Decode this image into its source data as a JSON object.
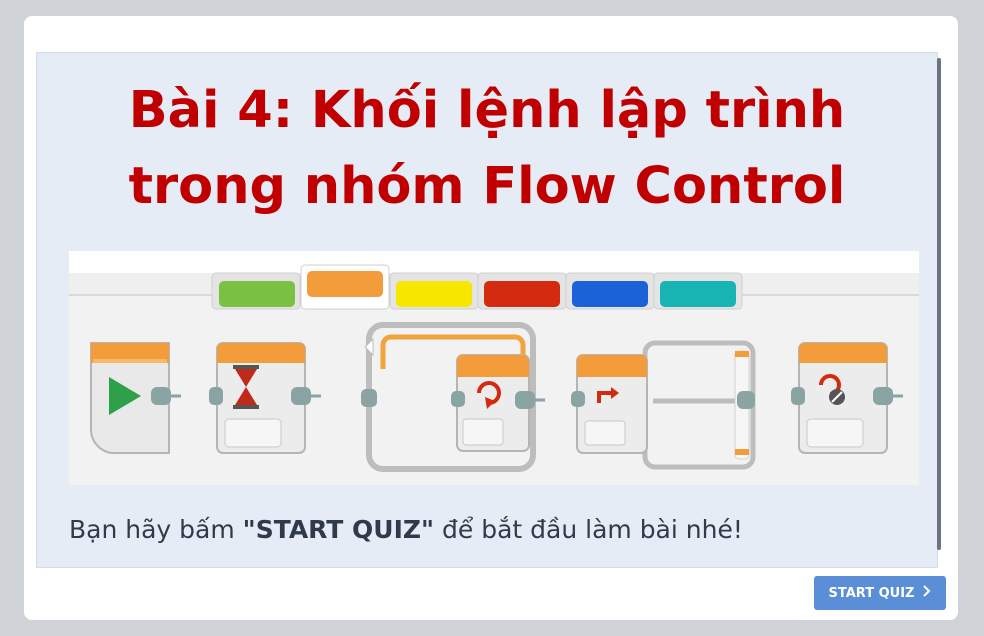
{
  "lesson": {
    "title_line1": "Bài 4: Khối lệnh lập trình",
    "title_line2": "trong nhóm Flow Control",
    "prompt_before": "Bạn hãy bấm ",
    "prompt_bold": "\"START QUIZ\"",
    "prompt_after": " để bắt đầu làm bài nhé!"
  },
  "quiz": {
    "start_label": "START QUIZ",
    "chevron_icon": "chevron-right-icon"
  },
  "palette": {
    "tab_colors": [
      "#7ac143",
      "#f39c3c",
      "#f6e600",
      "#d42a10",
      "#1a62d6",
      "#18b3b3"
    ],
    "selected_tab": 1,
    "blocks": [
      "start-block-icon",
      "wait-block-icon",
      "loop-block-icon",
      "switch-block-icon",
      "loop-interrupt-block-icon"
    ]
  },
  "colors": {
    "title": "#c00000",
    "button": "#5a8fd8",
    "panel": "#e6ecf6"
  }
}
